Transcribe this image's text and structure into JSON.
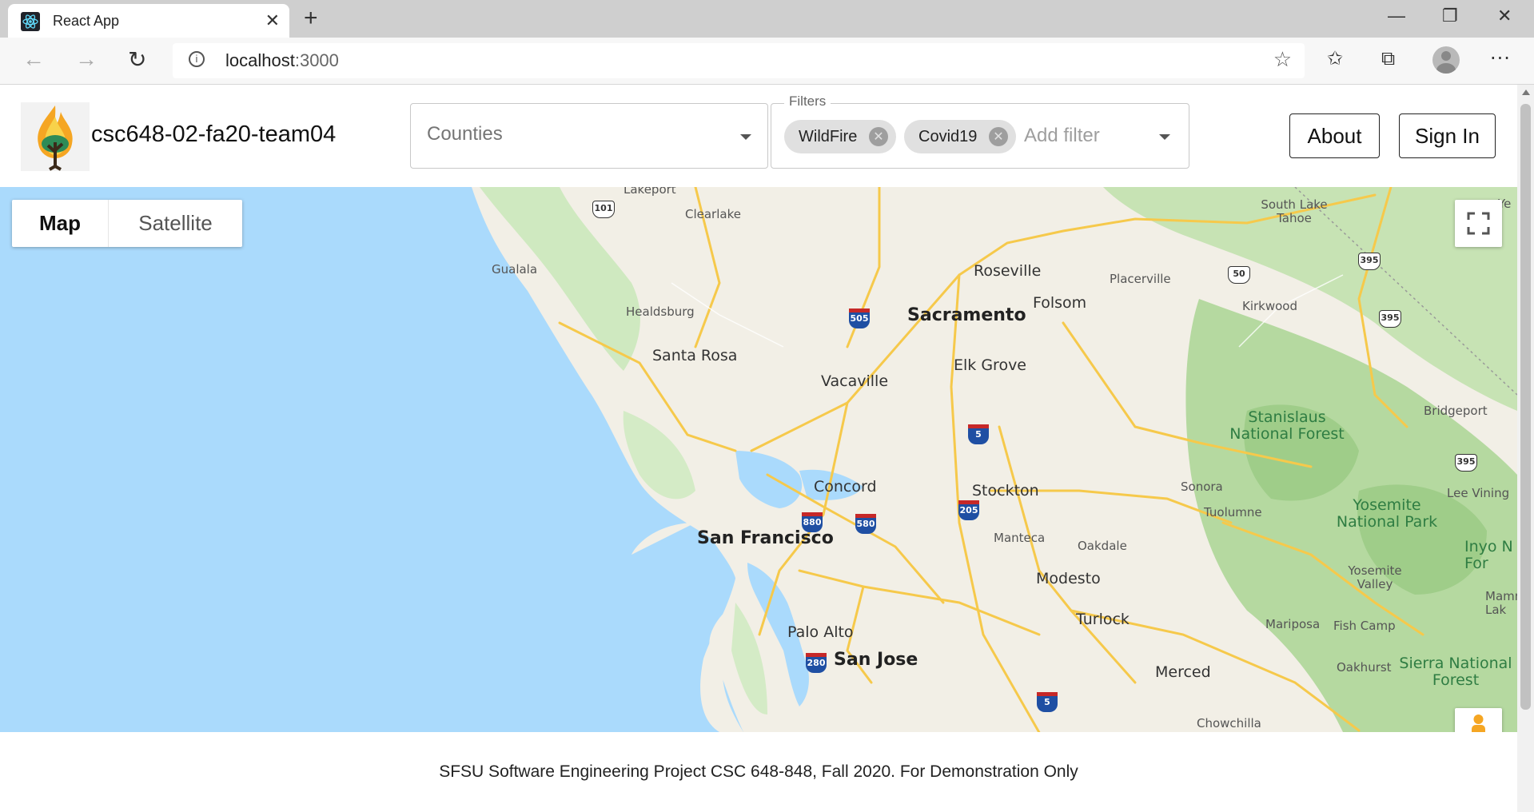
{
  "browser": {
    "tab_title": "React App",
    "tab_close": "✕",
    "new_tab": "+",
    "url_host": "localhost",
    "url_port": ":3000",
    "window": {
      "minimize": "—",
      "restore": "❐",
      "close": "✕"
    }
  },
  "header": {
    "brand": "csc648-02-fa20-team04",
    "counties_placeholder": "Counties",
    "filters_legend": "Filters",
    "chips": [
      {
        "label": "WildFire"
      },
      {
        "label": "Covid19"
      }
    ],
    "add_filter_placeholder": "Add filter",
    "about_label": "About",
    "signin_label": "Sign In"
  },
  "map": {
    "type_options": [
      "Map",
      "Satellite"
    ],
    "selected_type": "Map",
    "places": {
      "sacramento": "Sacramento",
      "san_francisco": "San Francisco",
      "san_jose": "San Jose",
      "santa_rosa": "Santa Rosa",
      "roseville": "Roseville",
      "folsom": "Folsom",
      "placerville": "Placerville",
      "elk_grove": "Elk Grove",
      "vacaville": "Vacaville",
      "concord": "Concord",
      "stockton": "Stockton",
      "manteca": "Manteca",
      "modesto": "Modesto",
      "oakdale": "Oakdale",
      "turlock": "Turlock",
      "merced": "Merced",
      "palo_alto": "Palo Alto",
      "healdsburg": "Healdsburg",
      "gualala": "Gualala",
      "lakeport": "Lakeport",
      "clearlake": "Clearlake",
      "kirkwood": "Kirkwood",
      "south_lake_tahoe": "South Lake Tahoe",
      "bridgeport": "Bridgeport",
      "sonora": "Sonora",
      "tuolumne": "Tuolumne",
      "lee_vining": "Lee Vining",
      "mariposa": "Mariposa",
      "fish_camp": "Fish Camp",
      "oakhurst": "Oakhurst",
      "chowchilla": "Chowchilla",
      "yosemite_valley": "Yosemite Valley",
      "mammoth": "Mamm Lak",
      "ye": "Ye",
      "stanislaus": "Stanislaus National Forest",
      "yosemite_np": "Yosemite National Park",
      "sierra_nf": "Sierra National Forest",
      "inyo": "Inyo N For"
    },
    "shields": {
      "i505": "505",
      "i5a": "5",
      "i5b": "5",
      "i880": "880",
      "i580": "580",
      "i280": "280",
      "i205": "205",
      "us101": "101",
      "us50": "50",
      "us395a": "395",
      "us395b": "395",
      "us395c": "395"
    }
  },
  "footer": {
    "text": "SFSU Software Engineering Project CSC 648-848, Fall 2020. For Demonstration Only"
  }
}
